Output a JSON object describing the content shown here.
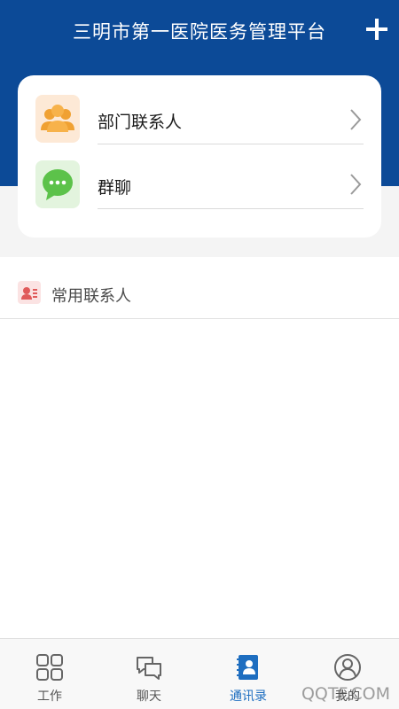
{
  "header": {
    "title": "三明市第一医院医务管理平台",
    "add_icon": "plus-icon",
    "background_color": "#0c4a97"
  },
  "card": {
    "items": [
      {
        "label": "部门联系人",
        "icon": "people-group-icon",
        "icon_color": "#f0a132"
      },
      {
        "label": "群聊",
        "icon": "chat-bubble-icon",
        "icon_color": "#5cc24a"
      }
    ]
  },
  "section": {
    "label": "常用联系人",
    "icon": "contact-card-icon"
  },
  "tabbar": {
    "tabs": [
      {
        "label": "工作",
        "icon": "grid-icon",
        "active": false
      },
      {
        "label": "聊天",
        "icon": "chat-icon",
        "active": false
      },
      {
        "label": "通讯录",
        "icon": "contacts-book-icon",
        "active": true
      },
      {
        "label": "我的",
        "icon": "user-icon",
        "active": false
      }
    ],
    "active_color": "#1e6ec0"
  },
  "watermark": "QQTF.COM"
}
